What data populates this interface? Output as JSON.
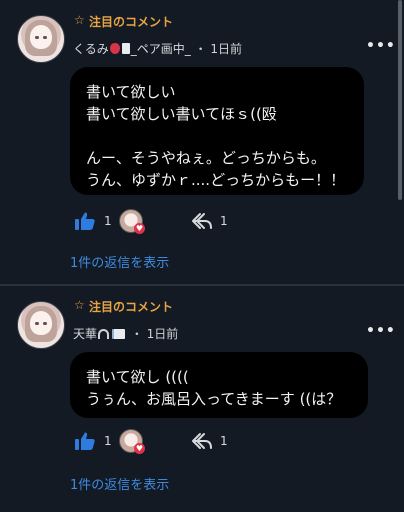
{
  "comments": [
    {
      "featured_label": "注目のコメント",
      "username": "くるみ",
      "username_suffix": "_ペア画中_",
      "time": "・ 1日前",
      "body": "書いて欲しい\n書いて欲しい書いてほｓ((殴\n\nんー、そうやねぇ。どっちからも。\nうん、ゆずかｒ....どっちからもー！！",
      "likes": "1",
      "shares": "1",
      "replies_label": "1件の返信を表示"
    },
    {
      "featured_label": "注目のコメント",
      "username": "天華",
      "username_suffix": "",
      "time": "・ 1日前",
      "body": "書いて欲し ((((\nうぅん、お風呂入ってきまーす ((は？",
      "likes": "1",
      "shares": "1",
      "replies_label": "1件の返信を表示"
    }
  ],
  "icons": {
    "star": "star-outline-icon",
    "more": "more-horizontal-icon",
    "like": "thumbs-up-icon",
    "share": "share-reply-icon",
    "heart": "heart-icon"
  },
  "colors": {
    "background": "#131a23",
    "bubble": "#000000",
    "featured": "#e8a443",
    "link": "#3d8be0",
    "like": "#2f7ce0"
  }
}
